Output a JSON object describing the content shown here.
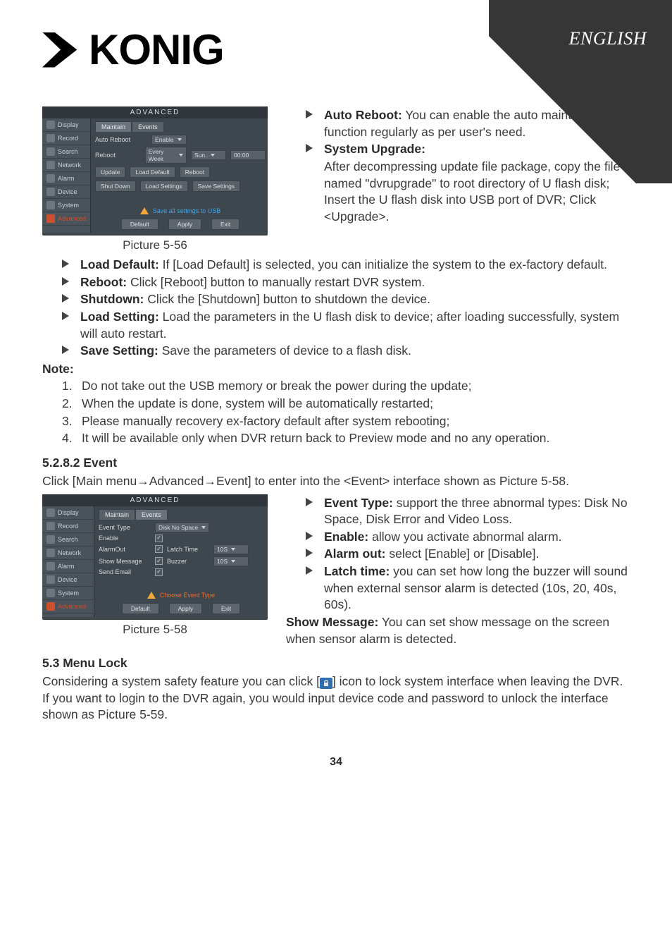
{
  "header": {
    "brand_word": "KONIG",
    "language_label": "ENGLISH"
  },
  "page_number": "34",
  "shot556": {
    "title": "ADVANCED",
    "caption": "Picture 5-56",
    "side_items": [
      "Display",
      "Record",
      "Search",
      "Network",
      "Alarm",
      "Device",
      "System",
      "Advanced"
    ],
    "side_active": "Advanced",
    "tabs": [
      "Maintain",
      "Events"
    ],
    "tab_active": "Maintain",
    "rows": {
      "auto_reboot_label": "Auto Reboot",
      "auto_reboot_value": "Enable",
      "reboot_label": "Reboot",
      "reboot_sched_a": "Every Week",
      "reboot_sched_b": "Sun.",
      "reboot_sched_c": "00:00"
    },
    "btnrow1": [
      "Update",
      "Load Default",
      "Reboot"
    ],
    "btnrow2": [
      "Shut Down",
      "Load Settings",
      "Save Settings"
    ],
    "warn": "Save all settings to USB",
    "footer": [
      "Default",
      "Apply",
      "Exit"
    ]
  },
  "right556": [
    {
      "label": "Auto Reboot:",
      "text": " You can enable the auto maintain function regularly as per user's need."
    },
    {
      "label": "System Upgrade:",
      "text": ""
    }
  ],
  "right556_upgrade_para": "After decompressing update file package, copy the file named \"dvrupgrade\" to root directory of U flash disk; Insert the U flash disk into USB port of DVR; Click <Upgrade>.",
  "full_bullets": [
    {
      "label": "Load Default:",
      "text": " If [Load Default] is selected, you can initialize the system to the ex-factory default."
    },
    {
      "label": "Reboot:",
      "text": " Click [Reboot] button to manually restart DVR system."
    },
    {
      "label": "Shutdown:",
      "text": " Click the [Shutdown] button to shutdown the device."
    },
    {
      "label": "Load Setting:",
      "text": " Load the parameters in the U flash disk to device; after loading successfully, system will auto restart."
    },
    {
      "label": "Save Setting:",
      "text": " Save the parameters of device to a flash disk."
    }
  ],
  "note_label": "Note:",
  "notes": [
    "Do not take out the USB memory or break the power during the update;",
    "When the update is done, system will be automatically restarted;",
    "Please manually recovery ex-factory default after system rebooting;",
    "It will be available only when DVR return back to Preview mode and no any operation."
  ],
  "section_event_heading": "5.2.8.2 Event",
  "event_intro": "Click [Main menu→Advanced→Event] to enter into the <Event> interface shown as Picture 5-58.",
  "shot558": {
    "title": "ADVANCED",
    "caption": "Picture 5-58",
    "side_items": [
      "Display",
      "Record",
      "Search",
      "Network",
      "Alarm",
      "Device",
      "System",
      "Advanced"
    ],
    "side_active": "Advanced",
    "tabs": [
      "Maintain",
      "Events"
    ],
    "tab_active": "Events",
    "rows": {
      "event_type_label": "Event Type",
      "event_type_value": "Disk No Space",
      "enable_label": "Enable",
      "alarmout_label": "AlarmOut",
      "latch_label": "Latch Time",
      "latch_value": "10S",
      "showmsg_label": "Show Message",
      "buzzer_label": "Buzzer",
      "buzzer_value": "10S",
      "sendemail_label": "Send Email"
    },
    "warn": "Choose Event Type",
    "footer": [
      "Default",
      "Apply",
      "Exit"
    ]
  },
  "right558": [
    {
      "label": "Event Type:",
      "text": " support the three abnormal types: Disk No Space, Disk Error and Video Loss."
    },
    {
      "label": "Enable:",
      "text": " allow you activate abnormal alarm."
    },
    {
      "label": "Alarm out:",
      "text": " select [Enable] or [Disable]."
    },
    {
      "label": "Latch time:",
      "text": " you can set how long the buzzer will sound when external sensor alarm is detected (10s, 20, 40s, 60s)."
    }
  ],
  "right558_tail_label": "Show Message:",
  "right558_tail_text": " You can set show message on the screen when sensor alarm is detected.",
  "section_lock_heading": "5.3 Menu Lock",
  "lock_para_a": "Considering a system safety feature you can click [",
  "lock_para_b": "] icon to lock system interface when leaving the DVR. If you want to login to the DVR again, you would input device code and password to unlock the interface shown as Picture 5-59."
}
